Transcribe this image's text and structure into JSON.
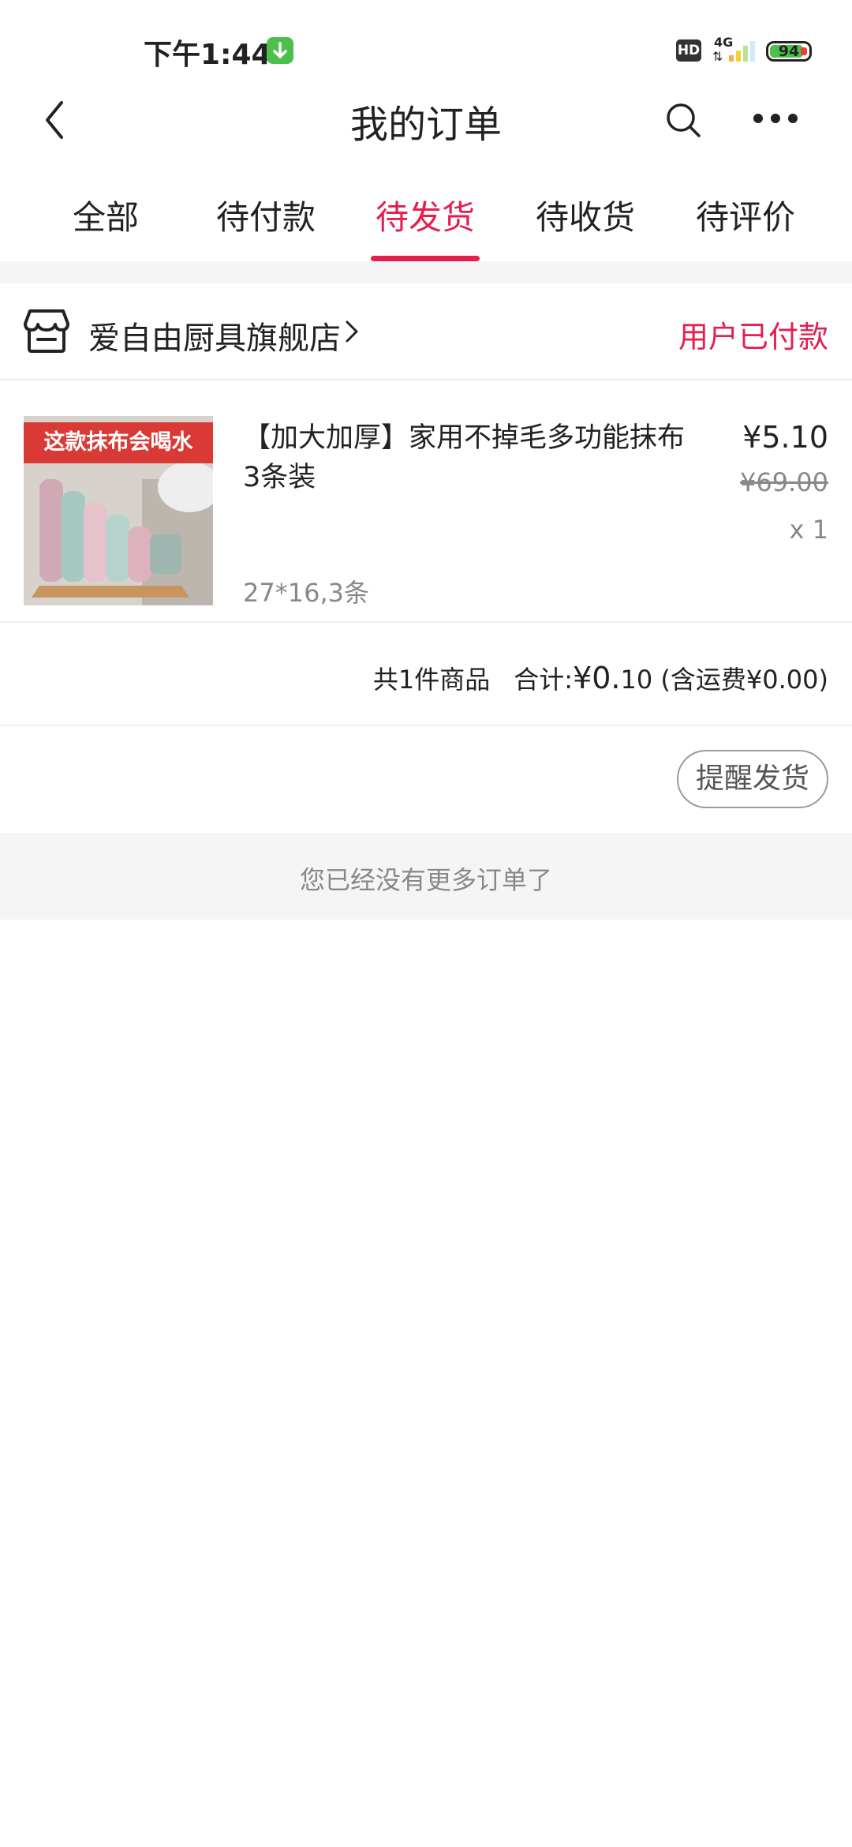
{
  "status_bar": {
    "time": "下午1:44",
    "hd_badge": "HD",
    "network": "4G",
    "battery": "94",
    "battery_level": 0.94
  },
  "header": {
    "title": "我的订单",
    "back_icon": "chevron-left-icon",
    "search_icon": "search-icon",
    "more_icon": "more-dots-icon"
  },
  "tabs": [
    {
      "label": "全部",
      "active": false
    },
    {
      "label": "待付款",
      "active": false
    },
    {
      "label": "待发货",
      "active": true
    },
    {
      "label": "待收货",
      "active": false
    },
    {
      "label": "待评价",
      "active": false
    }
  ],
  "order": {
    "shop_name": "爱自由厨具旗舰店",
    "status": "用户已付款",
    "product": {
      "image_text": "这款抹布会喝水",
      "title": "【加大加厚】家用不掉毛多功能抹布3条装",
      "sku": "27*16,3条",
      "price": "¥5.10",
      "original_price": "¥69.00",
      "quantity": "x 1"
    },
    "summary": {
      "count_text": "共1件商品",
      "total_label": "合计:",
      "total_prefix": "¥0.",
      "total_suffix": "10",
      "shipping": "(含运费¥0.00)"
    },
    "action_button": "提醒发货"
  },
  "footer_text": "您已经没有更多订单了",
  "colors": {
    "accent": "#e61e4d",
    "muted_text": "#888888",
    "band": "#f5f5f5"
  }
}
